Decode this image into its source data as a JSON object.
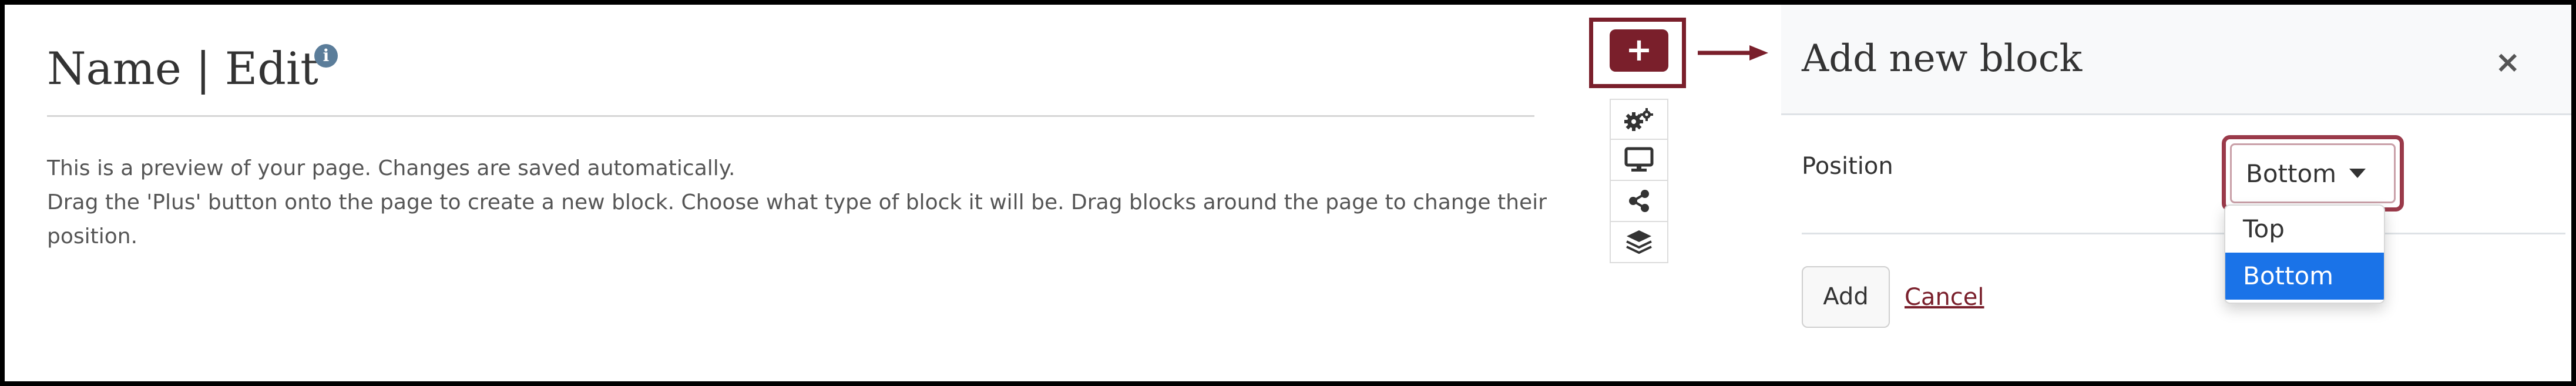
{
  "page": {
    "title": "Name | Edit",
    "info_icon": "info-icon",
    "description_line1": "This is a preview of your page. Changes are saved automatically.",
    "description_line2": "Drag the 'Plus' button onto the page to create a new block. Choose what type of block it will be. Drag blocks around the page to change their position."
  },
  "toolbar": {
    "add_label": "+",
    "items": [
      "gears-icon",
      "monitor-icon",
      "share-icon",
      "layers-icon"
    ]
  },
  "dialog": {
    "title": "Add new block",
    "close_label": "×",
    "position_label": "Position",
    "selected_position": "Bottom",
    "options": [
      "Top",
      "Bottom"
    ],
    "add_label": "Add",
    "cancel_label": "Cancel"
  },
  "colors": {
    "accent": "#7a1f2b",
    "selected_option": "#1a73e8",
    "info_icon": "#5b7d9a"
  }
}
